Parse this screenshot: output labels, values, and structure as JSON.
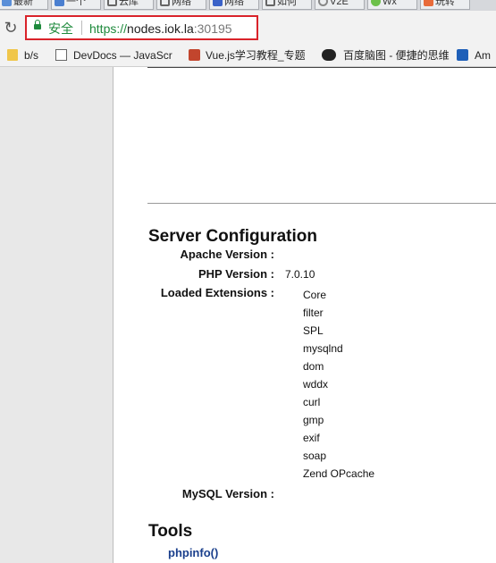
{
  "browser": {
    "tabs": [
      {
        "label": "最新",
        "icon": "doc-icon",
        "color": "#5a8fd8"
      },
      {
        "label": "一个",
        "icon": "grid-icon",
        "color": "#4a7fd0"
      },
      {
        "label": "云库",
        "icon": "bracket-icon",
        "color": "#666666"
      },
      {
        "label": "网络",
        "icon": "bracket-icon",
        "color": "#666666"
      },
      {
        "label": "网络",
        "icon": "house-icon",
        "color": "#3a62c8"
      },
      {
        "label": "如何",
        "icon": "bracket-icon",
        "color": "#666666"
      },
      {
        "label": "V2E",
        "icon": "v2-icon",
        "color": "#888888"
      },
      {
        "label": "Wx",
        "icon": "wx-icon",
        "color": "#6cc04a"
      },
      {
        "label": "玩转",
        "icon": "w-icon",
        "color": "#e86b3a"
      }
    ],
    "secure_label": "安全",
    "url_scheme": "https://",
    "url_host": "nodes.iok.la",
    "url_port": ":30195",
    "bookmarks": [
      {
        "label": "b/s",
        "icon": "folder-icon"
      },
      {
        "label": "DevDocs — JavaScr",
        "icon": "devdocs-icon"
      },
      {
        "label": "Vue.js学习教程_专题",
        "icon": "bookmark-b-icon"
      },
      {
        "label": "百度脑图 - 便捷的思维",
        "icon": "owl-icon"
      },
      {
        "label": "Am",
        "icon": "am-icon"
      }
    ]
  },
  "server": {
    "title": "Server Configuration",
    "apache_label": "Apache Version :",
    "apache_value": "",
    "php_label": "PHP Version :",
    "php_value": "7.0.10",
    "ext_label": "Loaded Extensions :",
    "extensions": [
      "Core",
      "filter",
      "SPL",
      "mysqlnd",
      "dom",
      "wddx",
      "curl",
      "gmp",
      "exif",
      "soap",
      "Zend OPcache"
    ],
    "mysql_label": "MySQL Version :",
    "mysql_value": ""
  },
  "tools": {
    "title": "Tools",
    "links": [
      "phpinfo()"
    ]
  }
}
